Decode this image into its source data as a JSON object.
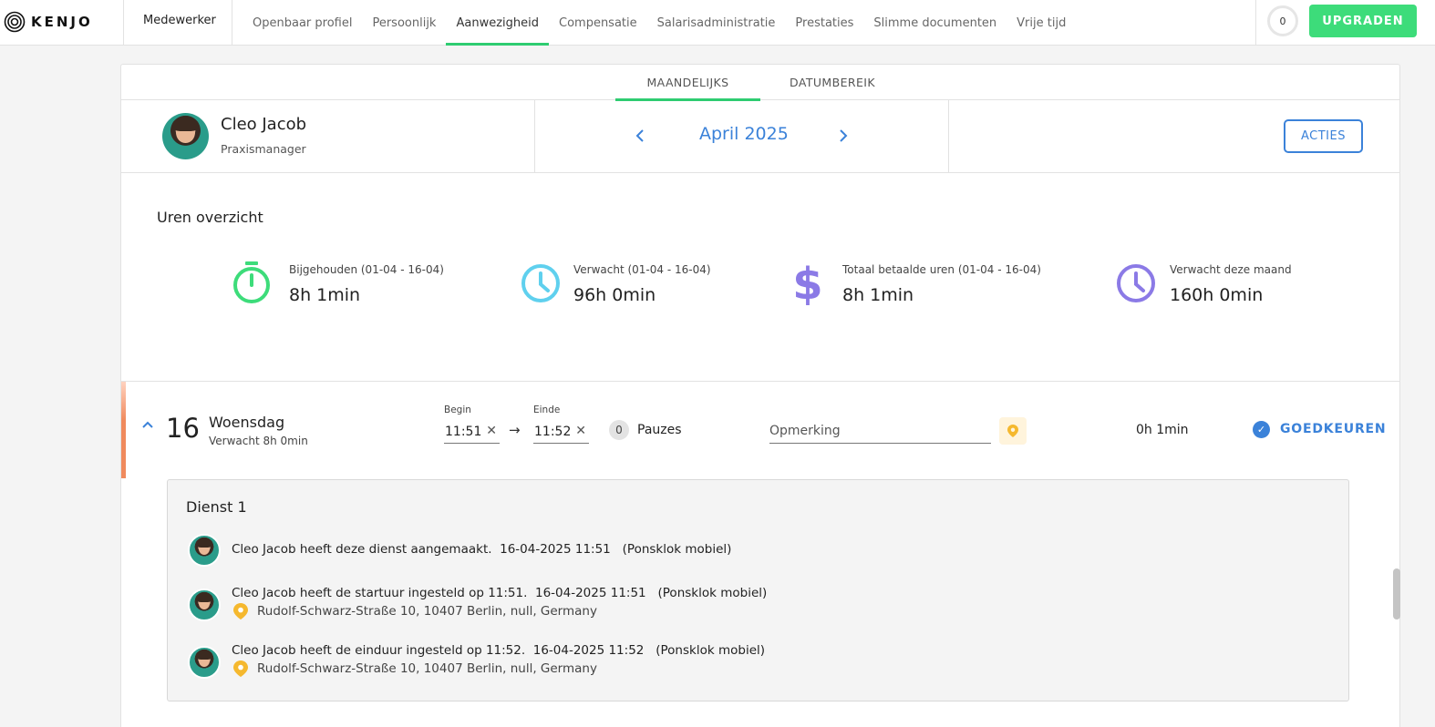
{
  "app": {
    "brand": "KENJO"
  },
  "header": {
    "section": "Medewerker",
    "tabs": [
      {
        "label": "Openbaar profiel"
      },
      {
        "label": "Persoonlijk"
      },
      {
        "label": "Aanwezigheid",
        "active": true
      },
      {
        "label": "Compensatie"
      },
      {
        "label": "Salarisadministratie"
      },
      {
        "label": "Prestaties"
      },
      {
        "label": "Slimme documenten"
      },
      {
        "label": "Vrije tijd"
      }
    ],
    "notifications": "0",
    "upgrade_label": "UPGRADEN"
  },
  "subtabs": {
    "monthly": "MAANDELIJKS",
    "range": "DATUMBEREIK"
  },
  "employee": {
    "name": "Cleo Jacob",
    "role": "Praxismanager"
  },
  "period": {
    "label": "April 2025"
  },
  "actions_label": "ACTIES",
  "overview": {
    "title": "Uren overzicht",
    "stats": [
      {
        "label": "Bijgehouden (01-04 - 16-04)",
        "value": "8h 1min",
        "icon": "stopwatch-icon"
      },
      {
        "label": "Verwacht (01-04 - 16-04)",
        "value": "96h 0min",
        "icon": "clock-icon"
      },
      {
        "label": "Totaal betaalde uren (01-04 - 16-04)",
        "value": "8h 1min",
        "icon": "dollar-icon"
      },
      {
        "label": "Verwacht deze maand",
        "value": "160h 0min",
        "icon": "clock-icon"
      }
    ]
  },
  "day": {
    "number": "16",
    "weekday": "Woensdag",
    "expected": "Verwacht 8h 0min",
    "begin_label": "Begin",
    "begin": "11:51",
    "end_label": "Einde",
    "end": "11:52",
    "arrow": "→",
    "pauses_count": "0",
    "pauses_label": "Pauzes",
    "remark_placeholder": "Opmerking",
    "total": "0h 1min",
    "approve_label": "GOEDKEUREN"
  },
  "shift": {
    "title": "Dienst 1",
    "log": [
      {
        "text": "Cleo Jacob heeft deze dienst aangemaakt.  16-04-2025 11:51   (Ponsklok mobiel)",
        "location": ""
      },
      {
        "text": "Cleo Jacob heeft de startuur ingesteld op 11:51.  16-04-2025 11:51   (Ponsklok mobiel)",
        "location": "Rudolf-Schwarz-Straße 10, 10407 Berlin, null, Germany"
      },
      {
        "text": "Cleo Jacob heeft de einduur ingesteld op 11:52.  16-04-2025 11:52   (Ponsklok mobiel)",
        "location": "Rudolf-Schwarz-Straße 10, 10407 Berlin, null, Germany"
      }
    ]
  },
  "colors": {
    "accent_green": "#3ddc7a",
    "link_blue": "#3b82d9",
    "purple": "#8b7ae6",
    "cyan": "#5fd0ee",
    "orange": "#f08a5d",
    "pin": "#f5b82e"
  }
}
